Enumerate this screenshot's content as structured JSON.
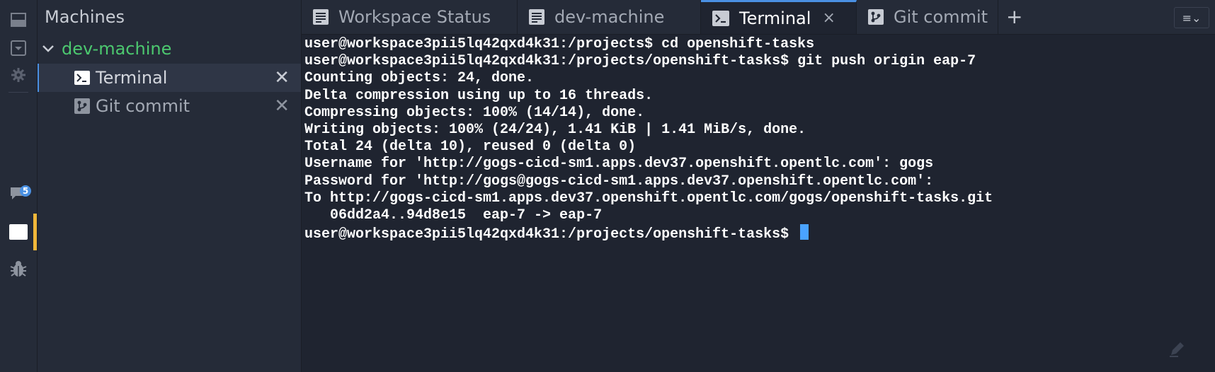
{
  "explorer": {
    "title": "Machines",
    "machine": "dev-machine",
    "items": [
      {
        "label": "Terminal",
        "icon": "terminal-icon"
      },
      {
        "label": "Git commit",
        "icon": "git-icon"
      }
    ],
    "close_glyph": "✕"
  },
  "rail": {
    "badge_count": "5",
    "accent_color": "#f0b73a"
  },
  "tabs": [
    {
      "label": "Workspace Status",
      "icon": "document-icon"
    },
    {
      "label": "dev-machine",
      "icon": "document-icon"
    },
    {
      "label": "Terminal",
      "icon": "terminal-icon",
      "active": true,
      "close": "×"
    },
    {
      "label": "Git commit",
      "icon": "git-icon"
    }
  ],
  "tabbar": {
    "add": "+",
    "menu": "≡⌄"
  },
  "terminal": {
    "lines": [
      "user@workspace3pii5lq42qxd4k31:/projects$ cd openshift-tasks",
      "user@workspace3pii5lq42qxd4k31:/projects/openshift-tasks$ git push origin eap-7",
      "Counting objects: 24, done.",
      "Delta compression using up to 16 threads.",
      "Compressing objects: 100% (14/14), done.",
      "Writing objects: 100% (24/24), 1.41 KiB | 1.41 MiB/s, done.",
      "Total 24 (delta 10), reused 0 (delta 0)",
      "Username for 'http://gogs-cicd-sm1.apps.dev37.openshift.opentlc.com': gogs",
      "Password for 'http://gogs@gogs-cicd-sm1.apps.dev37.openshift.opentlc.com':",
      "To http://gogs-cicd-sm1.apps.dev37.openshift.opentlc.com/gogs/openshift-tasks.git",
      "   06dd2a4..94d8e15  eap-7 -> eap-7"
    ],
    "prompt": "user@workspace3pii5lq42qxd4k31:/projects/openshift-tasks$ ",
    "cursor_color": "#4aa3ff"
  }
}
